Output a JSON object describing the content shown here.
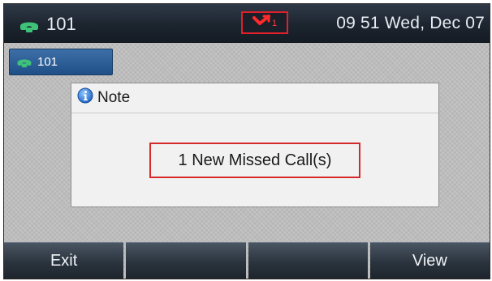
{
  "status_bar": {
    "line": "101",
    "missed_count": "1",
    "datetime": "09 51 Wed, Dec 07"
  },
  "line_key": {
    "label": "101"
  },
  "dialog": {
    "title": "Note",
    "message": "1 New Missed Call(s)"
  },
  "softkeys": [
    "Exit",
    "",
    "",
    "View"
  ],
  "icons": {
    "phone": "phone-icon",
    "missed_call": "missed-call-icon",
    "info": "info-icon"
  },
  "colors": {
    "highlight_red": "#e0202a",
    "phone_green": "#3ec27a",
    "line_key_blue": "#2c5f98"
  }
}
